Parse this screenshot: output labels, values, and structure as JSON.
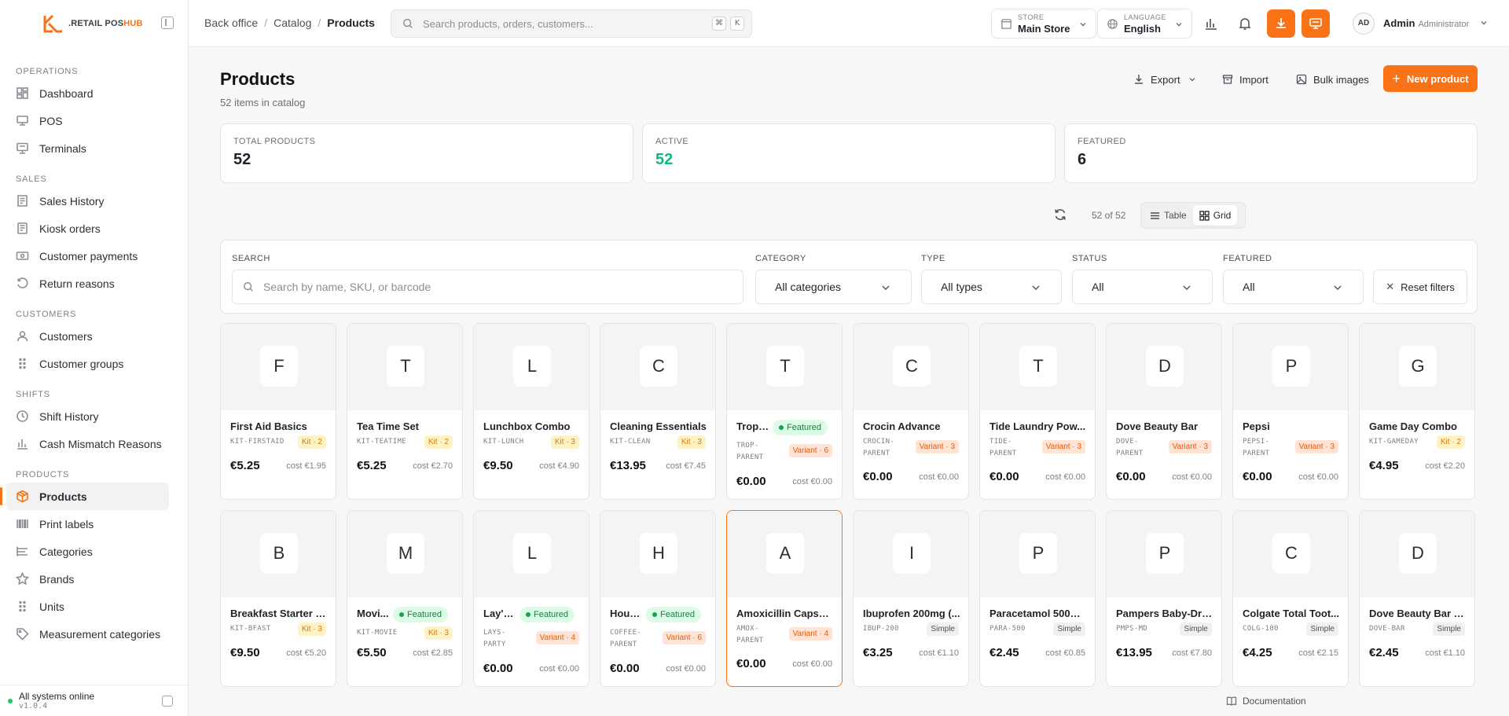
{
  "brand": {
    "prefix": ".RETAIL POS",
    "suffix": "HUB"
  },
  "sidebar": {
    "groups": [
      {
        "title": "OPERATIONS",
        "items": [
          {
            "label": "Dashboard",
            "icon": "dashboard-icon"
          },
          {
            "label": "POS",
            "icon": "pos-icon"
          },
          {
            "label": "Terminals",
            "icon": "terminal-icon"
          }
        ]
      },
      {
        "title": "SALES",
        "items": [
          {
            "label": "Sales History",
            "icon": "receipt-icon"
          },
          {
            "label": "Kiosk orders",
            "icon": "kiosk-icon"
          },
          {
            "label": "Customer payments",
            "icon": "cash-icon"
          },
          {
            "label": "Return reasons",
            "icon": "return-icon"
          }
        ]
      },
      {
        "title": "CUSTOMERS",
        "items": [
          {
            "label": "Customers",
            "icon": "users-icon"
          },
          {
            "label": "Customer groups",
            "icon": "grip-icon"
          }
        ]
      },
      {
        "title": "SHIFTS",
        "items": [
          {
            "label": "Shift History",
            "icon": "clock-icon"
          },
          {
            "label": "Cash Mismatch Reasons",
            "icon": "bar-chart-icon"
          }
        ]
      },
      {
        "title": "PRODUCTS",
        "items": [
          {
            "label": "Products",
            "icon": "box-icon",
            "active": true
          },
          {
            "label": "Print labels",
            "icon": "barcode-icon"
          },
          {
            "label": "Categories",
            "icon": "list-tree-icon"
          },
          {
            "label": "Brands",
            "icon": "star-icon"
          },
          {
            "label": "Units",
            "icon": "grip-icon"
          },
          {
            "label": "Measurement categories",
            "icon": "tag-icon"
          }
        ]
      }
    ],
    "footer": {
      "status": "All systems online",
      "version": "v1.0.4"
    }
  },
  "topbar": {
    "breadcrumb": [
      "Back office",
      "Catalog",
      "Products"
    ],
    "search_placeholder": "Search products, orders, customers...",
    "shortcut": [
      "⌘",
      "K"
    ],
    "store": {
      "label": "STORE",
      "value": "Main Store"
    },
    "language": {
      "label": "LANGUAGE",
      "value": "English"
    },
    "user": {
      "initials": "AD",
      "name": "Admin",
      "role": "Administrator"
    }
  },
  "page": {
    "title": "Products",
    "subtitle": "52 items in catalog",
    "actions": {
      "export": "Export",
      "import": "Import",
      "bulk_images": "Bulk images",
      "new_product": "New product"
    },
    "stats": [
      {
        "label": "TOTAL PRODUCTS",
        "value": "52"
      },
      {
        "label": "ACTIVE",
        "value": "52",
        "color": "#10b981"
      },
      {
        "label": "FEATURED",
        "value": "6"
      }
    ],
    "view": {
      "count": "52 of 52",
      "table": "Table",
      "grid": "Grid",
      "active": "Grid"
    },
    "filters": {
      "search_label": "SEARCH",
      "search_placeholder": "Search by name, SKU, or barcode",
      "category_label": "CATEGORY",
      "category_value": "All categories",
      "type_label": "TYPE",
      "type_value": "All types",
      "status_label": "STATUS",
      "status_value": "All",
      "featured_label": "FEATURED",
      "featured_value": "All",
      "reset": "Reset filters"
    },
    "footer_link": "Documentation"
  },
  "products": [
    {
      "letter": "F",
      "name": "First Aid Basics",
      "sku": [
        "KIT-FIRSTAID"
      ],
      "badge": "Kit · 2",
      "badge_type": "kit",
      "price": "€5.25",
      "cost": "cost €1.95"
    },
    {
      "letter": "T",
      "name": "Tea Time Set",
      "sku": [
        "KIT-TEATIME"
      ],
      "badge": "Kit · 2",
      "badge_type": "kit",
      "price": "€5.25",
      "cost": "cost €2.70"
    },
    {
      "letter": "L",
      "name": "Lunchbox Combo",
      "sku": [
        "KIT-LUNCH"
      ],
      "badge": "Kit · 3",
      "badge_type": "kit",
      "price": "€9.50",
      "cost": "cost €4.90"
    },
    {
      "letter": "C",
      "name": "Cleaning Essentials",
      "sku": [
        "KIT-CLEAN"
      ],
      "badge": "Kit · 3",
      "badge_type": "kit",
      "price": "€13.95",
      "cost": "cost €7.45"
    },
    {
      "letter": "T",
      "name": "Tropi...",
      "featured": "Featured",
      "sku": [
        "TROP-",
        "PARENT"
      ],
      "badge": "Variant · 6",
      "badge_type": "var",
      "price": "€0.00",
      "cost": "cost €0.00"
    },
    {
      "letter": "C",
      "name": "Crocin Advance",
      "sku": [
        "CROCIN-",
        "PARENT"
      ],
      "badge": "Variant · 3",
      "badge_type": "var",
      "price": "€0.00",
      "cost": "cost €0.00"
    },
    {
      "letter": "T",
      "name": "Tide Laundry Pow...",
      "sku": [
        "TIDE-",
        "PARENT"
      ],
      "badge": "Variant · 3",
      "badge_type": "var",
      "price": "€0.00",
      "cost": "cost €0.00"
    },
    {
      "letter": "D",
      "name": "Dove Beauty Bar",
      "sku": [
        "DOVE-",
        "PARENT"
      ],
      "badge": "Variant · 3",
      "badge_type": "var",
      "price": "€0.00",
      "cost": "cost €0.00"
    },
    {
      "letter": "P",
      "name": "Pepsi",
      "sku": [
        "PEPSI-",
        "PARENT"
      ],
      "badge": "Variant · 3",
      "badge_type": "var",
      "price": "€0.00",
      "cost": "cost €0.00"
    },
    {
      "letter": "G",
      "name": "Game Day Combo",
      "sku": [
        "KIT-GAMEDAY"
      ],
      "badge": "Kit · 2",
      "badge_type": "kit",
      "price": "€4.95",
      "cost": "cost €2.20"
    },
    {
      "letter": "B",
      "name": "Breakfast Starter P...",
      "sku": [
        "KIT-BFAST"
      ],
      "badge": "Kit · 3",
      "badge_type": "kit",
      "price": "€9.50",
      "cost": "cost €5.20"
    },
    {
      "letter": "M",
      "name": "Movi...",
      "featured": "Featured",
      "sku": [
        "KIT-MOVIE"
      ],
      "badge": "Kit · 3",
      "badge_type": "kit",
      "price": "€5.50",
      "cost": "cost €2.85"
    },
    {
      "letter": "L",
      "name": "Lay's ...",
      "featured": "Featured",
      "sku": [
        "LAYS-",
        "PARTY"
      ],
      "badge": "Variant · 4",
      "badge_type": "var",
      "price": "€0.00",
      "cost": "cost €0.00"
    },
    {
      "letter": "H",
      "name": "Hous...",
      "featured": "Featured",
      "sku": [
        "COFFEE-",
        "PARENT"
      ],
      "badge": "Variant · 6",
      "badge_type": "var",
      "price": "€0.00",
      "cost": "cost €0.00"
    },
    {
      "letter": "A",
      "name": "Amoxicillin Capsules",
      "sku": [
        "AMOX-",
        "PARENT"
      ],
      "badge": "Variant · 4",
      "badge_type": "var",
      "price": "€0.00",
      "cost": "cost €0.00",
      "selected": true
    },
    {
      "letter": "I",
      "name": "Ibuprofen 200mg (...",
      "sku": [
        "IBUP-200"
      ],
      "badge": "Simple",
      "badge_type": "simple",
      "price": "€3.25",
      "cost": "cost €1.10"
    },
    {
      "letter": "P",
      "name": "Paracetamol 500m...",
      "sku": [
        "PARA-500"
      ],
      "badge": "Simple",
      "badge_type": "simple",
      "price": "€2.45",
      "cost": "cost €0.85"
    },
    {
      "letter": "P",
      "name": "Pampers Baby-Dry...",
      "sku": [
        "PMPS-MD"
      ],
      "badge": "Simple",
      "badge_type": "simple",
      "price": "€13.95",
      "cost": "cost €7.80"
    },
    {
      "letter": "C",
      "name": "Colgate Total Toot...",
      "sku": [
        "COLG-100"
      ],
      "badge": "Simple",
      "badge_type": "simple",
      "price": "€4.25",
      "cost": "cost €2.15"
    },
    {
      "letter": "D",
      "name": "Dove Beauty Bar 1...",
      "sku": [
        "DOVE-BAR"
      ],
      "badge": "Simple",
      "badge_type": "simple",
      "price": "€2.45",
      "cost": "cost €1.10"
    }
  ],
  "colors": {
    "accent": "#f97316",
    "success": "#10b981"
  }
}
